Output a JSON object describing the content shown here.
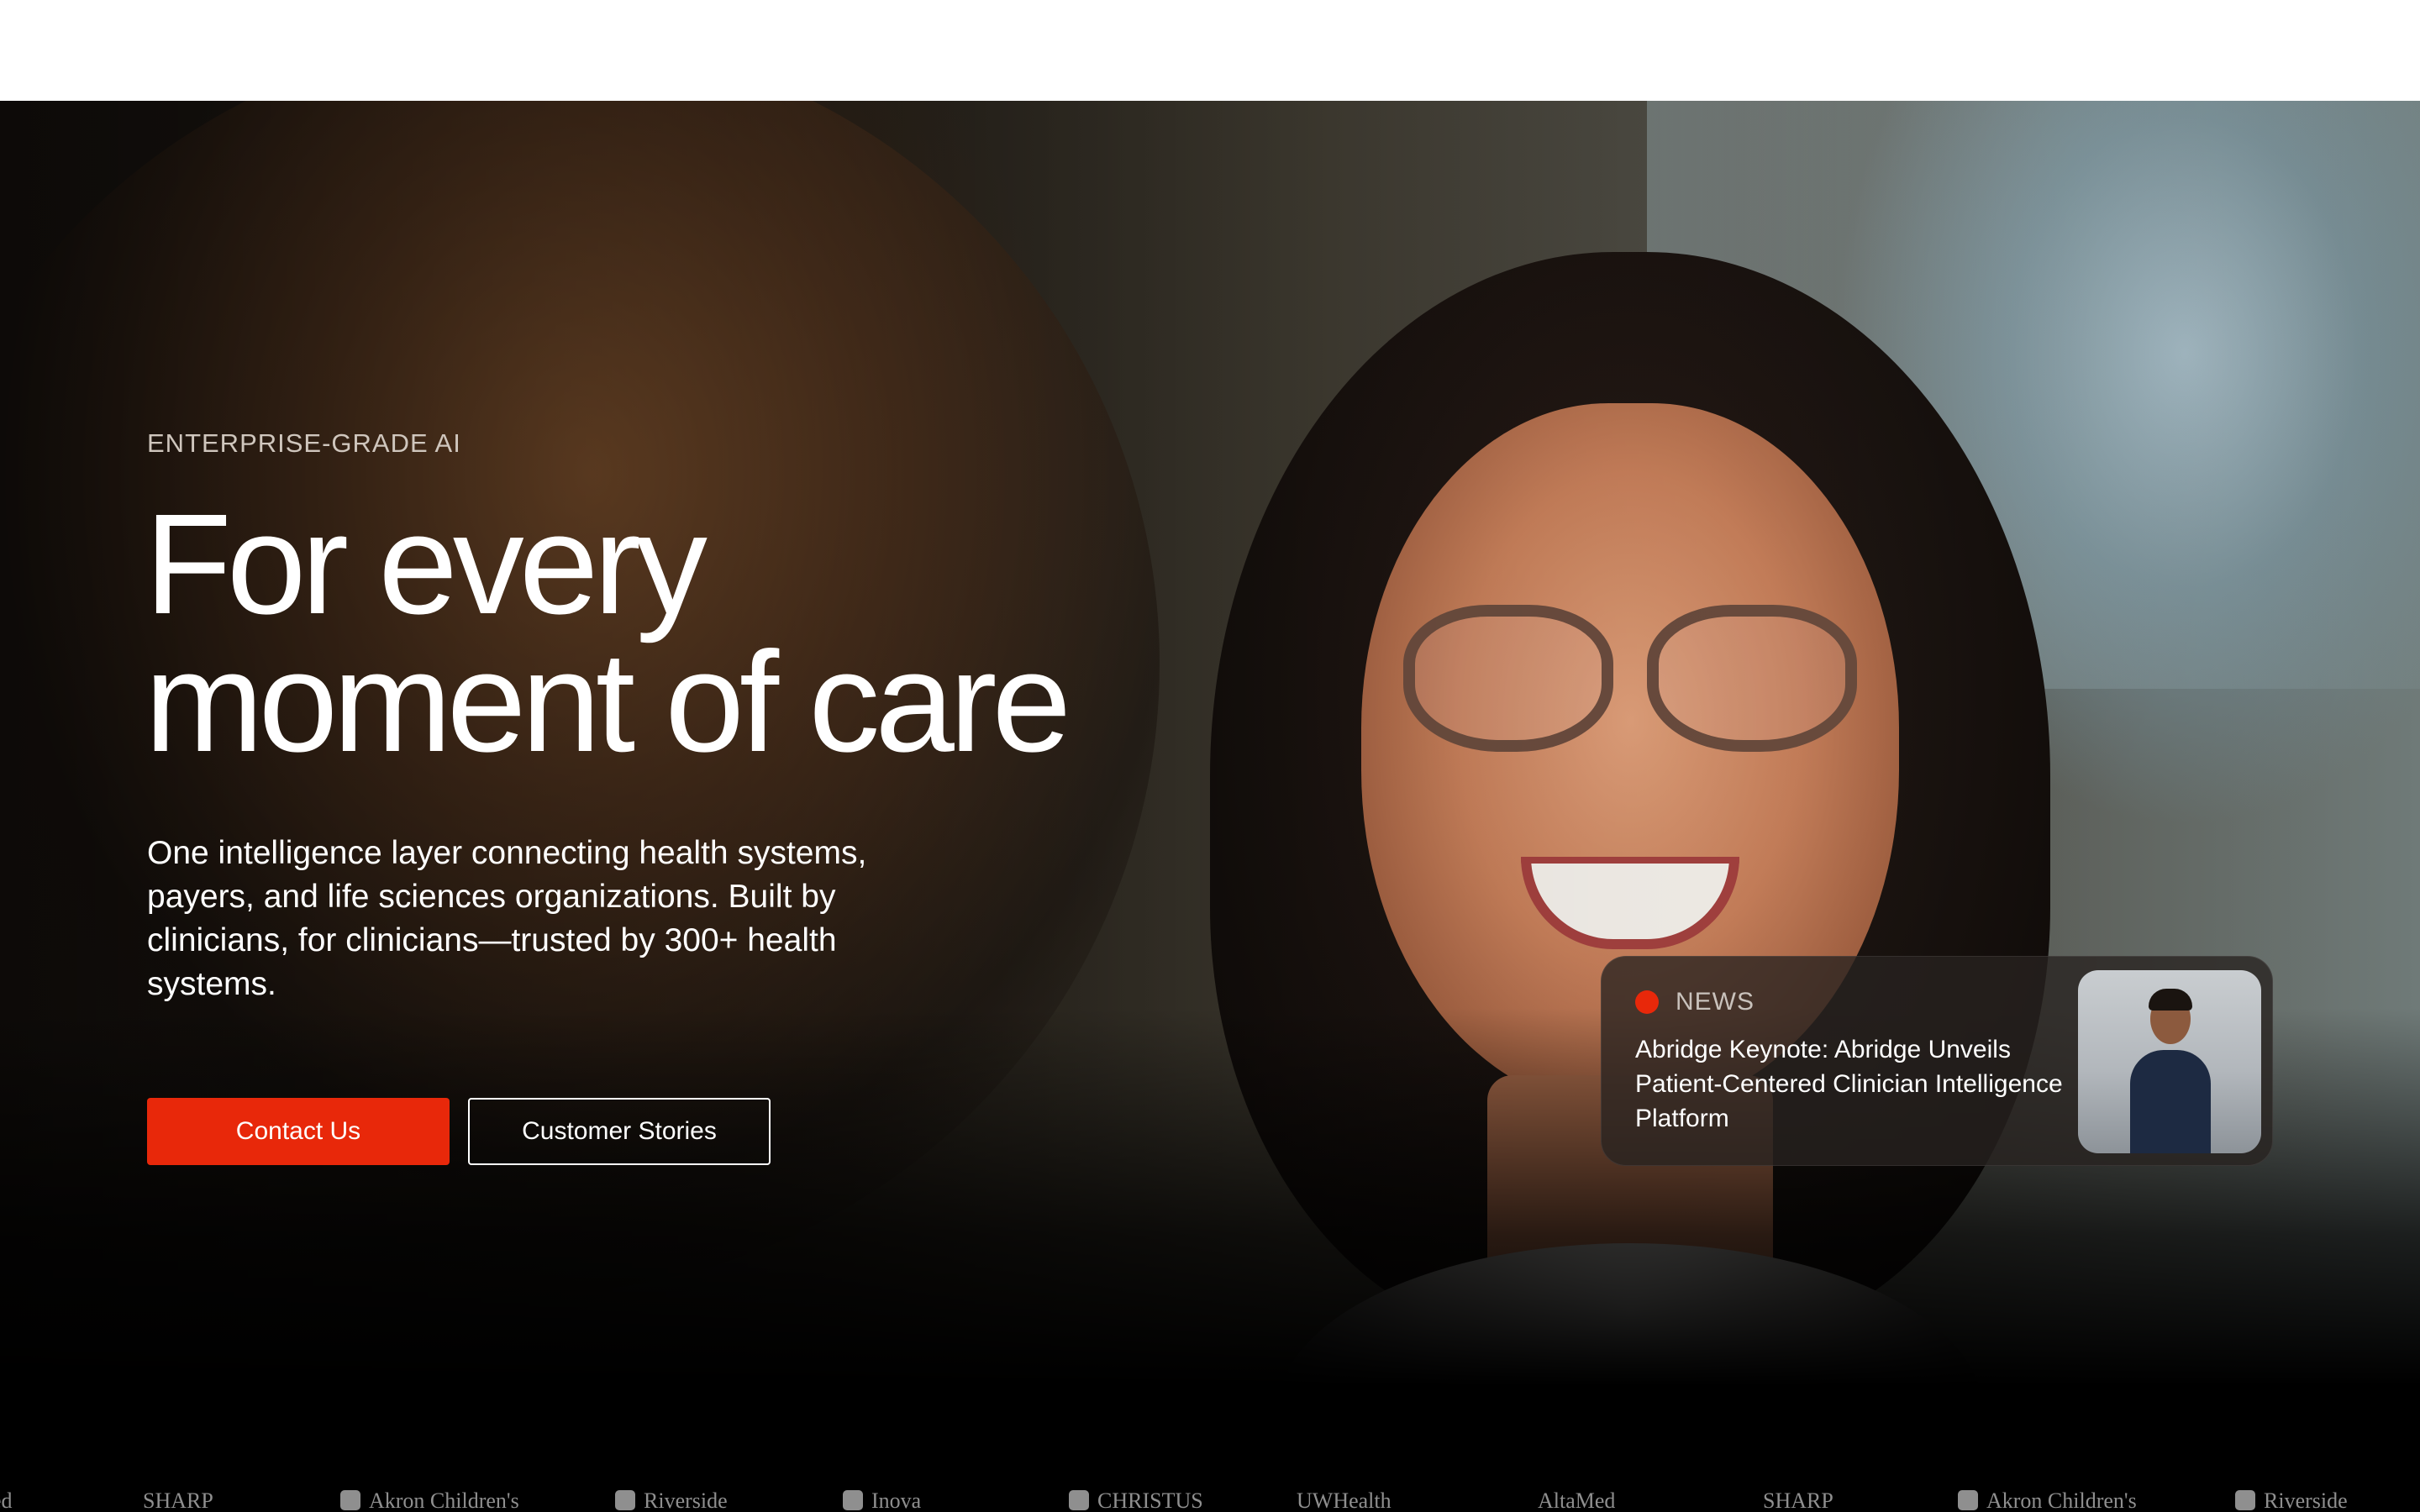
{
  "hero": {
    "eyebrow": "ENTERPRISE-GRADE AI",
    "headline_line1": "For every",
    "headline_line2": "moment of care",
    "subcopy": "One intelligence layer connecting health systems, payers, and life sciences organizations. Built by clinicians, for clinicians—trusted by 300+ health systems.",
    "primary_button": "Contact Us",
    "secondary_button": "Customer Stories"
  },
  "news": {
    "tag": "NEWS",
    "title": "Abridge Keynote: Abridge Unveils Patient-Centered Clinician Intelligence Platform"
  },
  "logos": [
    {
      "label": "ed",
      "icon": ""
    },
    {
      "label": "SHARP",
      "icon": ""
    },
    {
      "label": "Akron Children's",
      "icon": "shield-icon"
    },
    {
      "label": "Riverside",
      "icon": "shield-icon"
    },
    {
      "label": "Inova",
      "icon": "people-icon"
    },
    {
      "label": "CHRISTUS",
      "icon": "cross-icon"
    },
    {
      "label": "UWHealth",
      "icon": ""
    },
    {
      "label": "AltaMed",
      "icon": ""
    },
    {
      "label": "SHARP",
      "icon": ""
    },
    {
      "label": "Akron Children's",
      "icon": "shield-icon"
    },
    {
      "label": "Riverside",
      "icon": "shield-icon"
    }
  ],
  "colors": {
    "accent": "#e8280a",
    "background_dark": "#000000",
    "text_light": "#ffffff"
  }
}
